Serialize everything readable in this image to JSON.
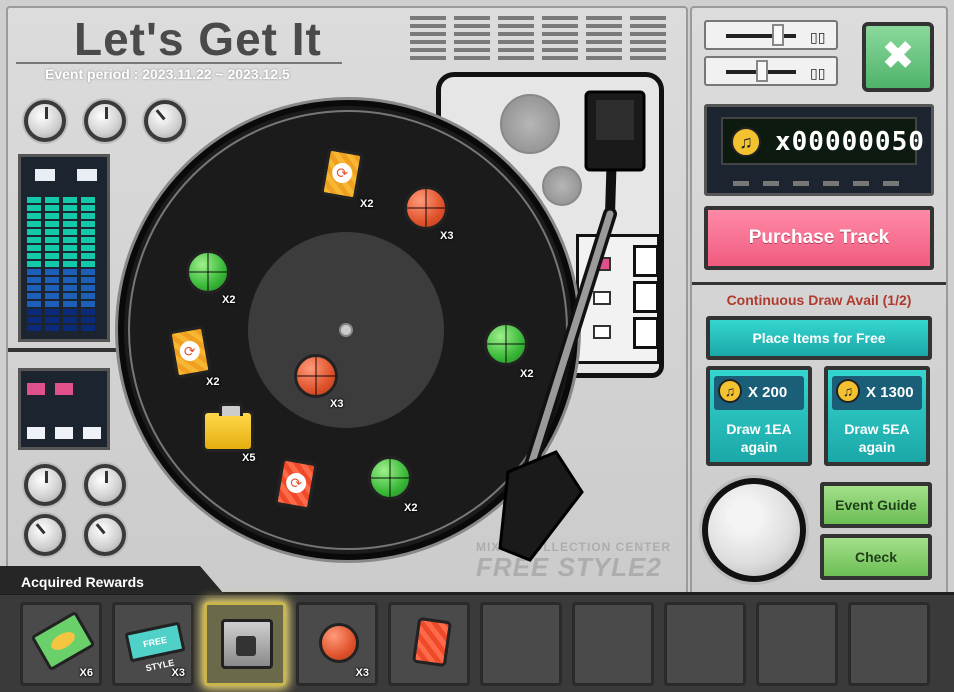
{
  "event": {
    "title": "Let's Get It",
    "period": "Event period : 2023.11.22 ~ 2023.12.5"
  },
  "record_items": [
    {
      "icon": "orange-card-icon",
      "qty": "X2"
    },
    {
      "icon": "orange-basketball-icon",
      "qty": "X3"
    },
    {
      "icon": "green-basketball-icon",
      "qty": "X2"
    },
    {
      "icon": "green-basketball-icon",
      "qty": "X2"
    },
    {
      "icon": "orange-card-icon",
      "qty": "X2"
    },
    {
      "icon": "orange-basketball-icon",
      "qty": "X3"
    },
    {
      "icon": "yellow-toolbox-icon",
      "qty": "X5"
    },
    {
      "icon": "red-card-icon",
      "qty": ""
    },
    {
      "icon": "green-basketball-icon",
      "qty": "X2"
    }
  ],
  "watermark": {
    "small": "MIXED COLLECTION CENTER",
    "big": "FREE STYLE2"
  },
  "currency": {
    "icon": "music-note-icon",
    "value": "x00000050"
  },
  "purchase_button": "Purchase Track",
  "continuous_draw": "Continuous Draw Avail (1/2)",
  "place_free_button": "Place Items for Free",
  "draw_options": [
    {
      "cost": "X 200",
      "label_line1": "Draw 1EA",
      "label_line2": "again"
    },
    {
      "cost": "X 1300",
      "label_line1": "Draw 5EA",
      "label_line2": "again"
    }
  ],
  "buttons": {
    "event_guide": "Event Guide",
    "check": "Check"
  },
  "rewards": {
    "title": "Acquired Rewards",
    "slots": [
      {
        "icon": "cash-bundle-icon",
        "qty": "X6",
        "highlight": false
      },
      {
        "icon": "free-style-ticket-icon",
        "ticket_text": "FREE STYLE",
        "qty": "X3",
        "highlight": false
      },
      {
        "icon": "amp-box-icon",
        "qty": "",
        "highlight": true
      },
      {
        "icon": "orange-basketball-icon",
        "qty": "X3",
        "highlight": false
      },
      {
        "icon": "red-card-icon",
        "qty": "",
        "highlight": false
      },
      {
        "icon": "",
        "qty": "",
        "highlight": false
      },
      {
        "icon": "",
        "qty": "",
        "highlight": false
      },
      {
        "icon": "",
        "qty": "",
        "highlight": false
      },
      {
        "icon": "",
        "qty": "",
        "highlight": false
      },
      {
        "icon": "",
        "qty": "",
        "highlight": false
      }
    ]
  },
  "colors": {
    "purchase": "#f05b80",
    "teal": "#1ba7a8",
    "green_button": "#6cbe55",
    "close_button": "#4fb36a",
    "title_text": "#4a4a4a",
    "continuous_text": "#b03a2e"
  }
}
